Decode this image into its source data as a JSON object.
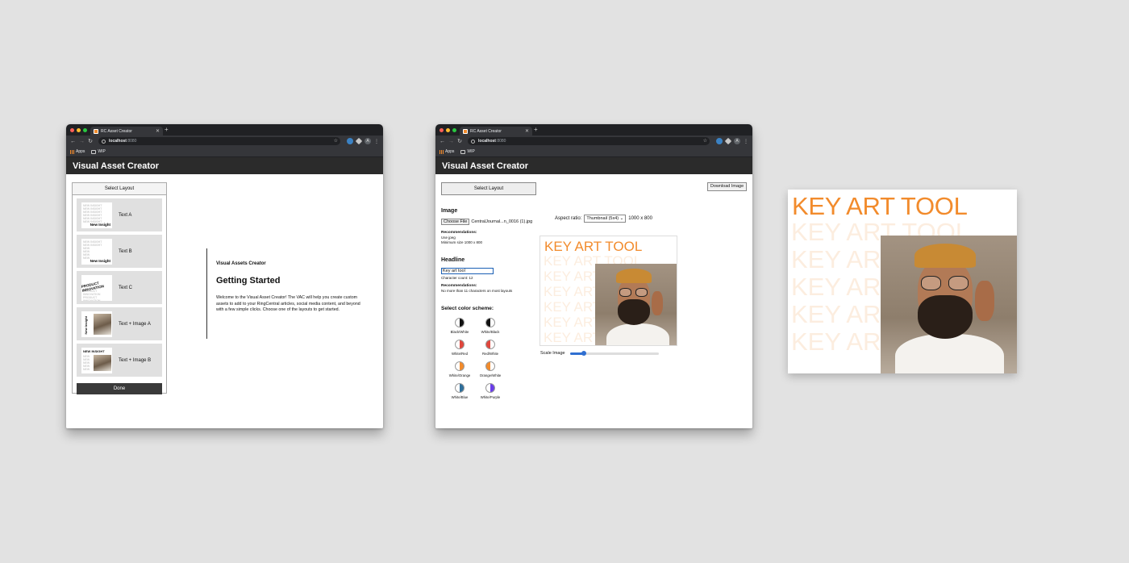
{
  "browser_common": {
    "tab_title": "RC Asset Creator",
    "url_host": "localhost",
    "url_port": ":8080",
    "bookmark_apps": "Apps",
    "bookmark_wip": "WIP",
    "profile_initial": "A",
    "app_title": "Visual Asset Creator"
  },
  "layout_panel": {
    "header": "Select Layout",
    "items": [
      {
        "label": "Text A",
        "thumb_text": "New Insight"
      },
      {
        "label": "Text B",
        "thumb_text": "New Insight"
      },
      {
        "label": "Text C",
        "thumb_text": "PRODUCT INNOVATION"
      },
      {
        "label": "Text + Image A",
        "thumb_text": "New Insight"
      },
      {
        "label": "Text + Image B",
        "thumb_text": "NEW INSIGHT"
      }
    ],
    "done_label": "Done"
  },
  "welcome": {
    "kicker": "Visual Assets Creator",
    "title": "Getting Started",
    "body": "Welcome to the Visual Asset Creator! The VAC will help you create custom assets to add to your RingCentral articles, social media content, and beyond with a few simple clicks. Choose one of the layouts to get started."
  },
  "editor": {
    "select_layout": "Select Layout",
    "download": "Download Image",
    "image_section": "Image",
    "choose_file": "Choose File",
    "file_name": "CentralJournal...n_0016 (1).jpg",
    "image_rec_title": "Recommendations:",
    "image_rec_1": "Use jpeg",
    "image_rec_2": "Minimum size 1000 x 800",
    "aspect_label": "Aspect ratio:",
    "aspect_value": "Thumbnail (5x4)",
    "aspect_dims": "1000 x 800",
    "headline_section": "Headline",
    "headline_value": "Key art tool",
    "char_count": "Character count: 12",
    "headline_rec_title": "Recommendations:",
    "headline_rec_1": "No more than 11 characters on most layouts",
    "color_section": "Select color scheme:",
    "color_schemes": [
      {
        "label": "Black/White",
        "left": "#ffffff",
        "right": "#111111"
      },
      {
        "label": "White/Black",
        "left": "#111111",
        "right": "#ffffff"
      },
      {
        "label": "White/Red",
        "left": "#ffffff",
        "right": "#e0463c"
      },
      {
        "label": "Red/White",
        "left": "#e0463c",
        "right": "#ffffff"
      },
      {
        "label": "White/Orange",
        "left": "#ffffff",
        "right": "#f28b2c"
      },
      {
        "label": "Orange/White",
        "left": "#f28b2c",
        "right": "#ffffff"
      },
      {
        "label": "White/Blue",
        "left": "#ffffff",
        "right": "#2e6e9a"
      },
      {
        "label": "White/Purple",
        "left": "#ffffff",
        "right": "#6a3de8"
      }
    ],
    "scale_label": "Scale Image",
    "scale_value": 0.16
  },
  "preview": {
    "headline": "KEY ART TOOL",
    "ghost_line": "KEY ART TOOL",
    "accent": "#f28b2c"
  }
}
